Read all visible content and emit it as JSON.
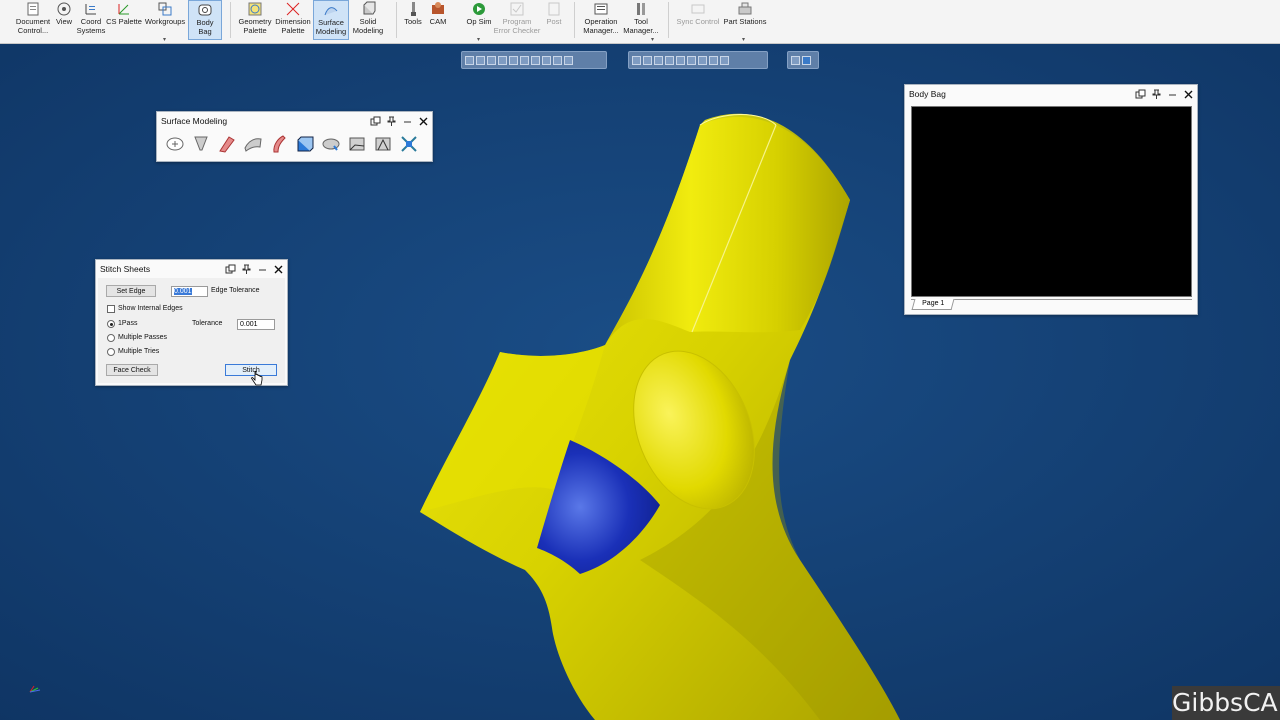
{
  "ribbon": {
    "items": [
      {
        "label": "Document\nControl...",
        "icon": "document-icon"
      },
      {
        "label": "View",
        "icon": "view-icon"
      },
      {
        "label": "Coord\nSystems",
        "icon": "coord-systems-icon"
      },
      {
        "label": "CS Palette",
        "icon": "cs-palette-icon"
      },
      {
        "label": "Workgroups",
        "icon": "workgroups-icon"
      },
      {
        "label": "Body Bag",
        "icon": "body-bag-icon"
      },
      {
        "label": "Geometry\nPalette",
        "icon": "geometry-palette-icon"
      },
      {
        "label": "Dimension\nPalette",
        "icon": "dimension-palette-icon"
      },
      {
        "label": "Surface\nModeling",
        "icon": "surface-modeling-icon"
      },
      {
        "label": "Solid\nModeling",
        "icon": "solid-modeling-icon"
      },
      {
        "label": "Tools",
        "icon": "tools-icon"
      },
      {
        "label": "CAM",
        "icon": "cam-icon"
      },
      {
        "label": "Op Sim",
        "icon": "op-sim-icon"
      },
      {
        "label": "Program\nError Checker",
        "icon": "error-checker-icon"
      },
      {
        "label": "Post",
        "icon": "post-icon"
      },
      {
        "label": "Operation\nManager...",
        "icon": "operation-manager-icon"
      },
      {
        "label": "Tool\nManager...",
        "icon": "tool-manager-icon"
      },
      {
        "label": "Sync Control",
        "icon": "sync-control-icon"
      },
      {
        "label": "Part Stations",
        "icon": "part-stations-icon"
      }
    ]
  },
  "surface_modeling": {
    "title": "Surface Modeling",
    "tools": [
      "point-icon",
      "cone-surface-icon",
      "ruled-surface-icon",
      "patch-surface-icon",
      "sweep-surface-icon",
      "box-surface-icon",
      "revolve-surface-icon",
      "blend-surface-icon",
      "fillet-surface-icon",
      "stitch-surface-icon"
    ]
  },
  "stitch_sheets": {
    "title": "Stitch Sheets",
    "set_edge_label": "Set Edge",
    "edge_tolerance_value": "0.001",
    "edge_tolerance_label": "Edge Tolerance",
    "show_internal_edges_label": "Show Internal Edges",
    "options": [
      "1Pass",
      "Multiple Passes",
      "Multiple Tries"
    ],
    "selected_option": "1Pass",
    "tolerance_label": "Tolerance",
    "tolerance_value": "0.001",
    "face_check_label": "Face Check",
    "stitch_label": "Stitch"
  },
  "body_bag": {
    "title": "Body Bag",
    "tab_label": "Page 1"
  },
  "brand": {
    "logo_text": "GibbsCAM"
  },
  "colors": {
    "viewport_bg": "#14437a",
    "model_yellow": "#e8e400",
    "selected_face": "#1428a8"
  }
}
